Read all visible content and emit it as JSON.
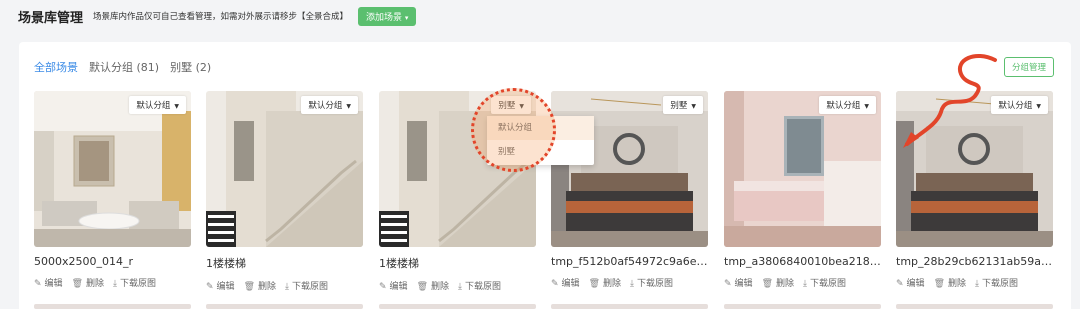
{
  "header": {
    "title": "场景库管理",
    "hint": "场景库内作品仅可自己查看管理，如需对外展示请移步【全景合成】",
    "add_label": "添加场景"
  },
  "filters": [
    {
      "label": "全部场景",
      "active": true
    },
    {
      "label": "默认分组 (81)",
      "active": false
    },
    {
      "label": "别墅 (2)",
      "active": false
    }
  ],
  "group_manage_label": "分组管理",
  "cards": [
    {
      "name": "5000x2500_014_r",
      "group": "默认分组",
      "scene": "living-room"
    },
    {
      "name": "1楼楼梯",
      "group": "默认分组",
      "scene": "stairs"
    },
    {
      "name": "1楼楼梯",
      "group": "别墅",
      "scene": "stairs"
    },
    {
      "name": "tmp_f512b0af54972c9a6e2c...",
      "group": "别墅",
      "scene": "bedroom-dark"
    },
    {
      "name": "tmp_a3806840010bea218b6...",
      "group": "默认分组",
      "scene": "bedroom-pink"
    },
    {
      "name": "tmp_28b29cb62131ab59a3d...",
      "group": "默认分组",
      "scene": "bedroom-dark"
    }
  ],
  "card_actions": {
    "edit": "编辑",
    "delete": "删除",
    "download": "下载原图"
  },
  "dropdown": {
    "options": [
      "默认分组",
      "别墅"
    ]
  },
  "colors": {
    "accent_green": "#5bbf6f",
    "link_blue": "#3b8be6",
    "annotation_red": "#e2452a"
  }
}
